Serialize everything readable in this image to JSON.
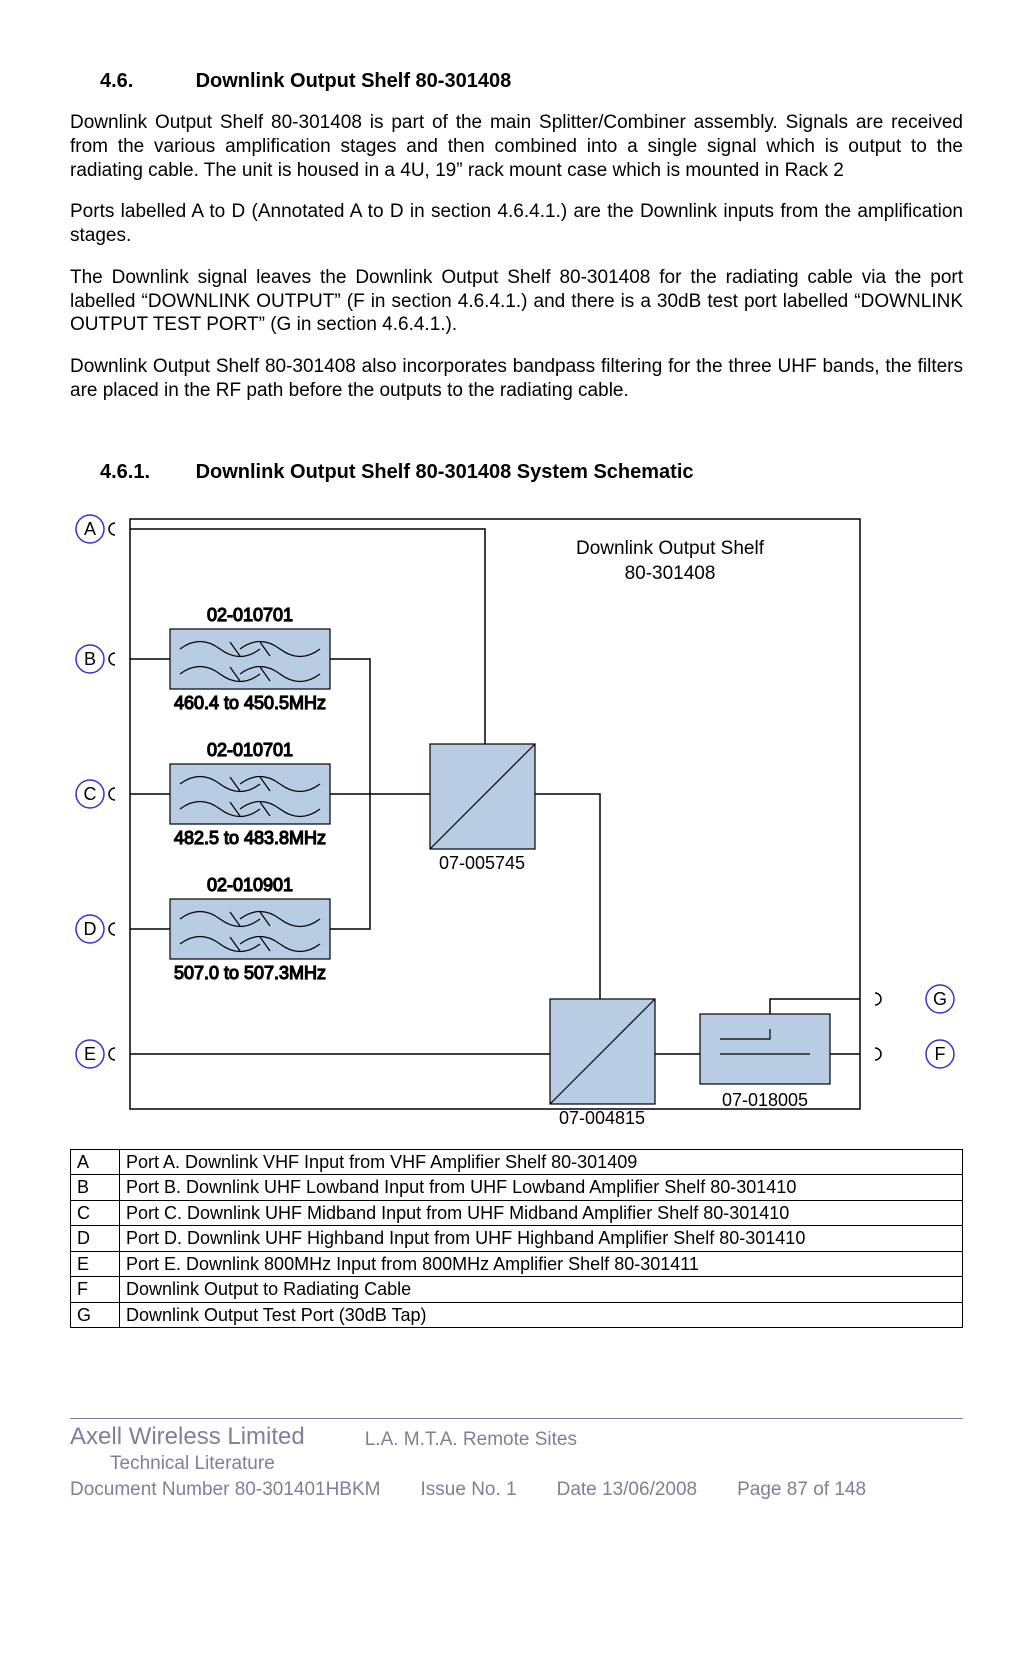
{
  "section": {
    "num": "4.6.",
    "title": "Downlink Output Shelf 80-301408"
  },
  "paragraphs": {
    "p1": "Downlink Output Shelf 80-301408 is part of the main Splitter/Combiner assembly. Signals are received from the various amplification stages and then combined into a single signal which is output to the radiating cable. The unit is housed in a 4U, 19” rack mount case which is mounted in Rack 2",
    "p2": "Ports labelled A to D (Annotated A to D in section 4.6.4.1.) are the Downlink inputs from the amplification stages.",
    "p3": "The Downlink signal leaves the Downlink Output Shelf 80-301408 for the radiating cable via the port labelled “DOWNLINK OUTPUT” (F in section 4.6.4.1.) and there is a 30dB test port labelled “DOWNLINK OUTPUT TEST PORT” (G in section 4.6.4.1.).",
    "p4": "Downlink Output Shelf 80-301408 also incorporates bandpass filtering for the three UHF bands, the filters are placed in the RF path before the outputs to the radiating cable."
  },
  "subsection": {
    "num": "4.6.1.",
    "title": "Downlink Output Shelf 80-301408 System Schematic"
  },
  "diagram": {
    "title_line1": "Downlink Output Shelf",
    "title_line2": "80-301408",
    "ports": {
      "A": "A",
      "B": "B",
      "C": "C",
      "D": "D",
      "E": "E",
      "F": "F",
      "G": "G"
    },
    "blocks": {
      "f1_top": "02-010701",
      "f1_bottom": "460.4 to 450.5MHz",
      "f2_top": "02-010701",
      "f2_bottom": "482.5 to 483.8MHz",
      "f3_top": "02-010901",
      "f3_bottom": "507.0 to 507.3MHz",
      "combiner1": "07-005745",
      "combiner2": "07-004815",
      "coupler": "07-018005"
    }
  },
  "port_table": [
    {
      "key": "A",
      "desc": "Port A. Downlink VHF Input from VHF Amplifier Shelf 80-301409"
    },
    {
      "key": "B",
      "desc": "Port B. Downlink UHF Lowband Input from UHF Lowband Amplifier Shelf 80-301410"
    },
    {
      "key": "C",
      "desc": "Port C. Downlink UHF Midband Input from UHF Midband Amplifier Shelf 80-301410"
    },
    {
      "key": "D",
      "desc": "Port D. Downlink UHF Highband Input from UHF Highband Amplifier Shelf 80-301410"
    },
    {
      "key": "E",
      "desc": "Port E. Downlink 800MHz Input from 800MHz Amplifier Shelf 80-301411"
    },
    {
      "key": "F",
      "desc": "Downlink Output to Radiating Cable"
    },
    {
      "key": "G",
      "desc": "Downlink Output Test Port (30dB Tap)"
    }
  ],
  "footer": {
    "brand": "Axell Wireless Limited",
    "tech": "Technical Literature",
    "remote": "L.A. M.T.A. Remote Sites",
    "docnum": "Document Number 80-301401HBKM",
    "issue": "Issue No. 1",
    "date": "Date 13/06/2008",
    "page": "Page 87 of 148"
  }
}
